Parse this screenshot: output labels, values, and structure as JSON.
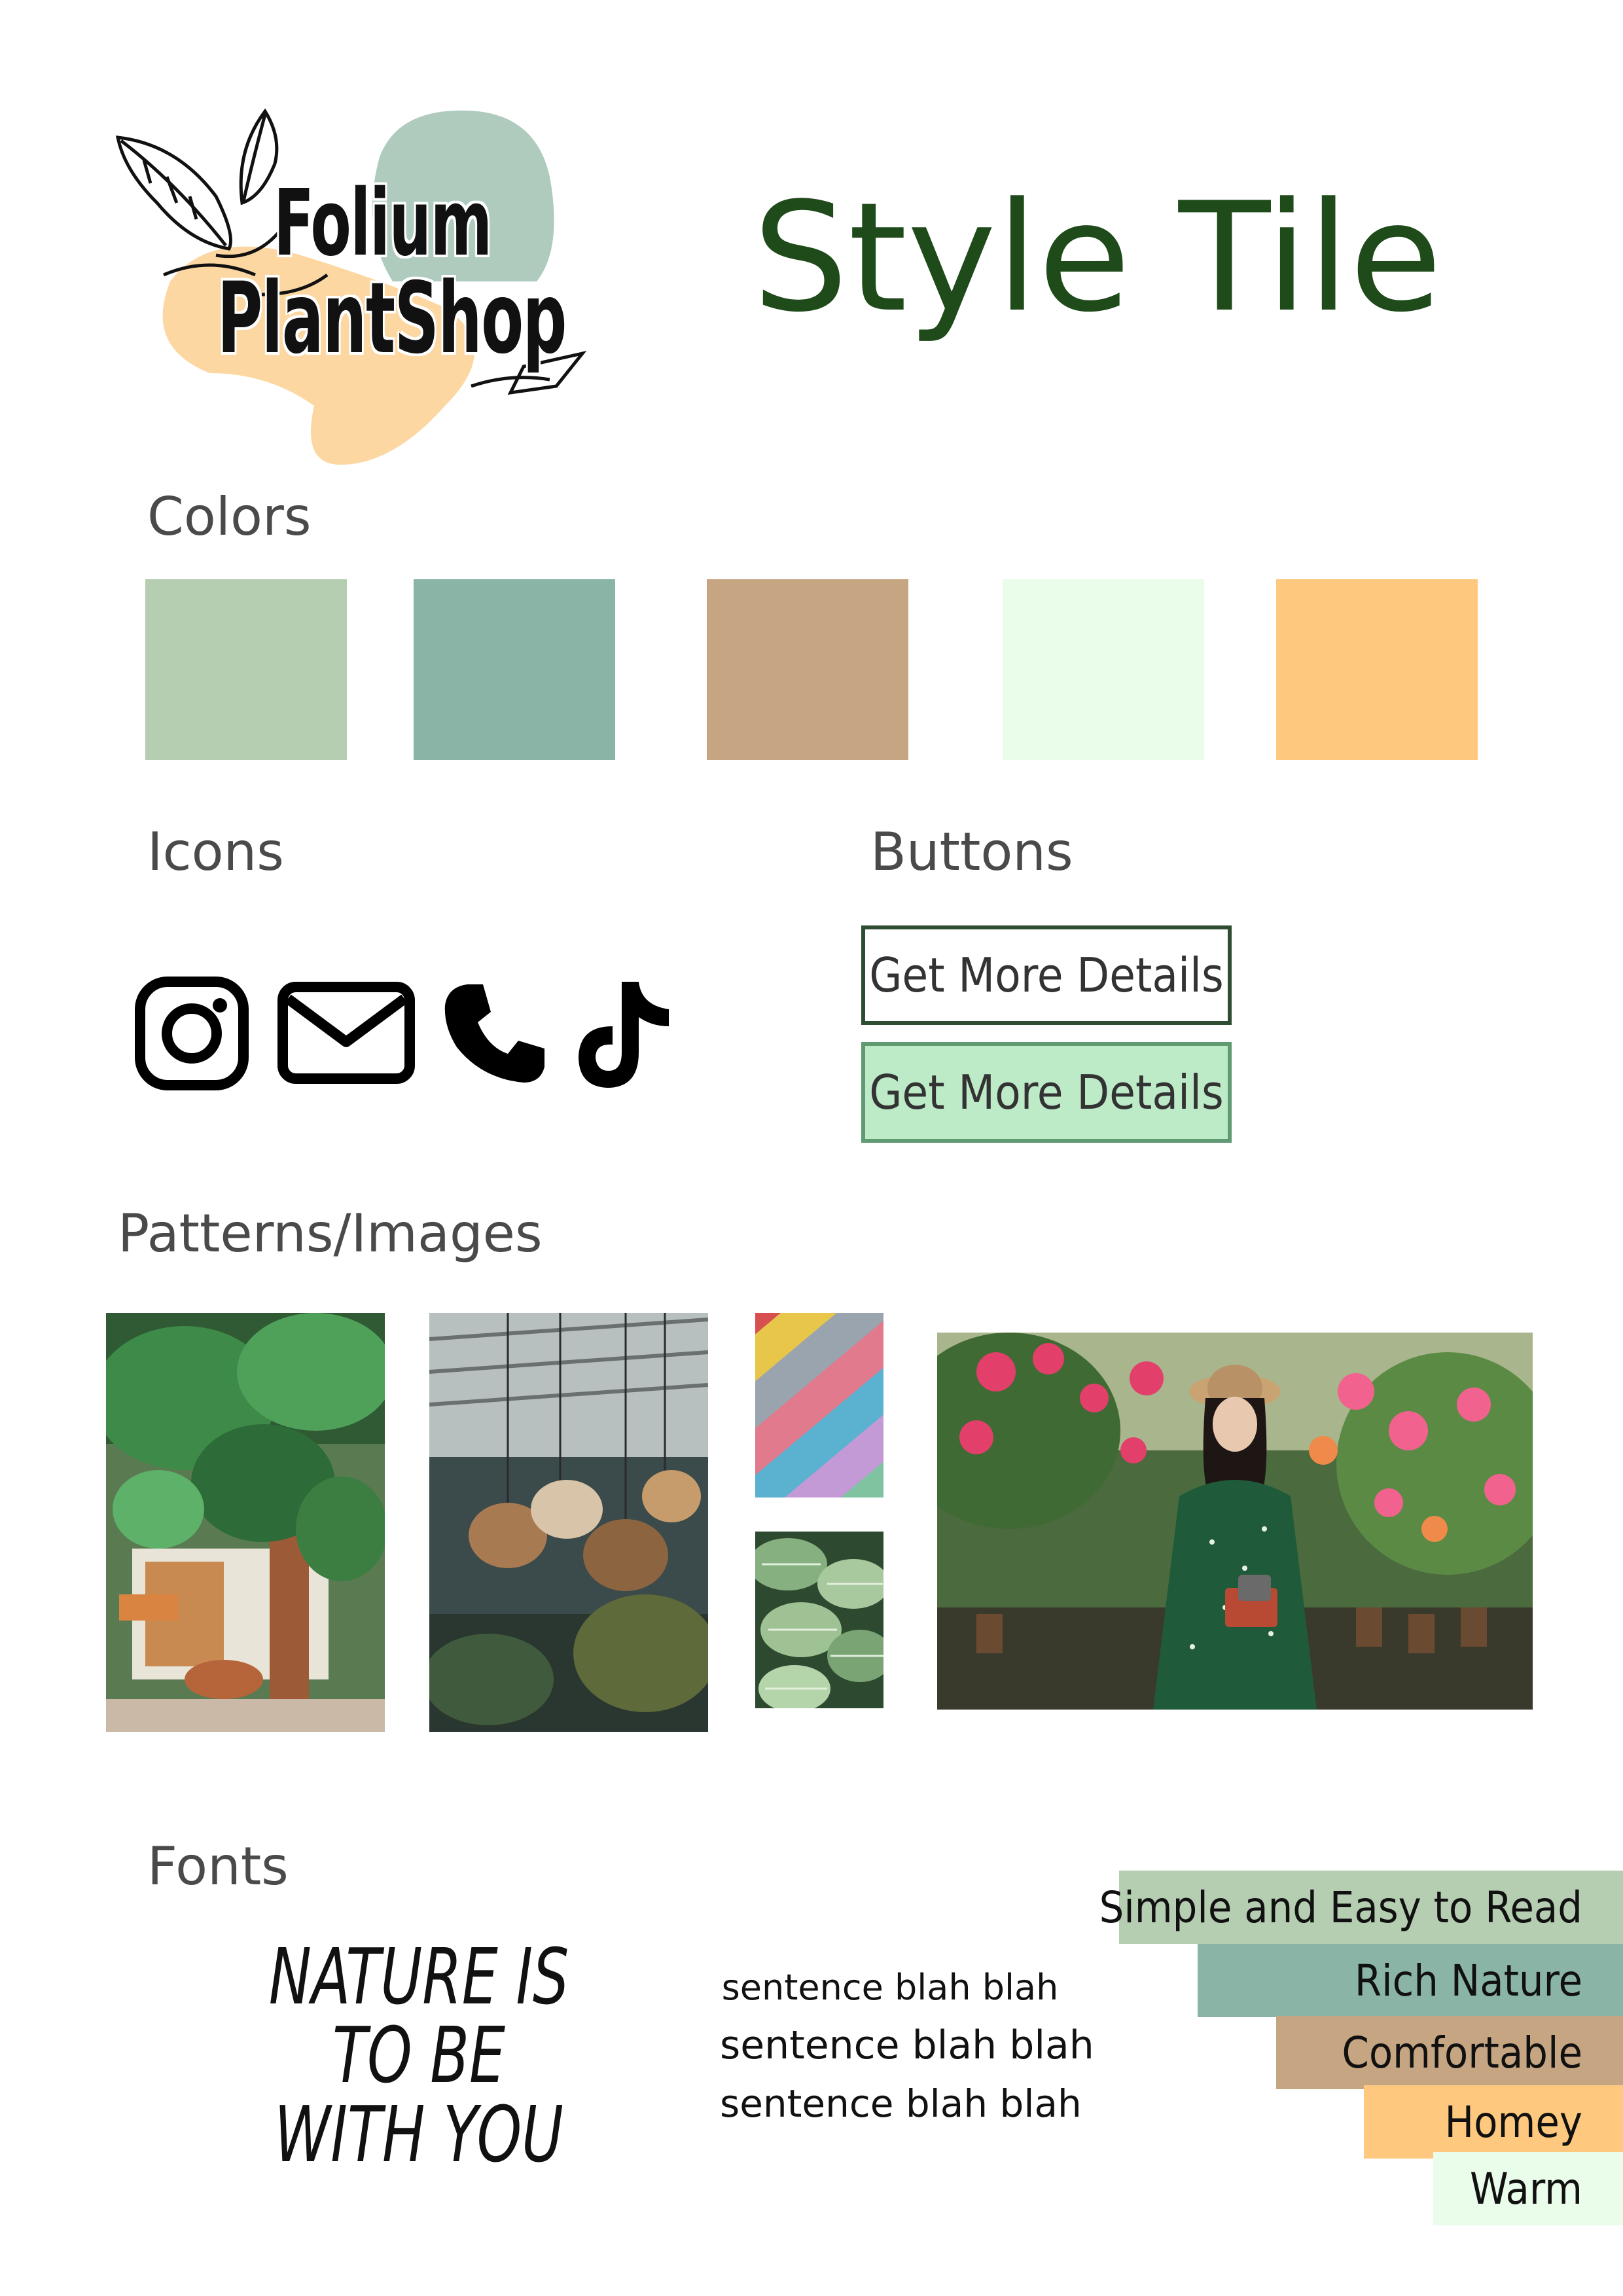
{
  "logo": {
    "line1": "Folium",
    "line2": "PlantShop"
  },
  "title": "Style Tile",
  "sections": {
    "colors": "Colors",
    "icons": "Icons",
    "buttons": "Buttons",
    "patterns": "Patterns/Images",
    "fonts": "Fonts"
  },
  "palette": [
    "#b5cdb1",
    "#8ab5a6",
    "#c6a582",
    "#eafcea",
    "#fec97f"
  ],
  "icons": [
    "instagram-icon",
    "mail-icon",
    "phone-icon",
    "tiktok-icon"
  ],
  "buttons": {
    "outline_label": "Get More Details",
    "filled_label": "Get More Details",
    "outline_border": "#2e4d33",
    "filled_bg": "#bdebc8",
    "filled_border": "#5f9a73"
  },
  "fonts": {
    "display_sample": "NATURE IS\nTO BE\nWITH YOU",
    "body_samples": [
      "sentence blah blah",
      "sentence blah blah",
      "sentence blah blah"
    ]
  },
  "keywords": [
    {
      "label": "Simple and Easy to Read",
      "color": "#b5cdb1"
    },
    {
      "label": "Rich Nature",
      "color": "#8ab5a6"
    },
    {
      "label": "Comfortable",
      "color": "#c6a582"
    },
    {
      "label": "Homey",
      "color": "#fec97f"
    },
    {
      "label": "Warm",
      "color": "#eafcea"
    }
  ]
}
